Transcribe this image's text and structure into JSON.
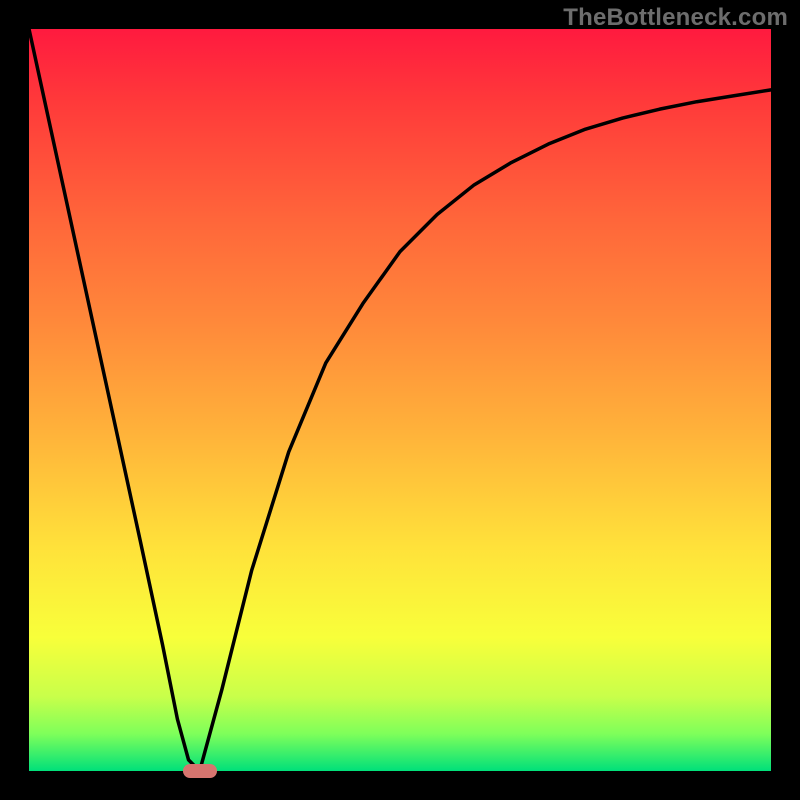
{
  "watermark": "TheBottleneck.com",
  "chart_data": {
    "type": "line",
    "title": "",
    "xlabel": "",
    "ylabel": "",
    "xlim": [
      0,
      100
    ],
    "ylim": [
      0,
      100
    ],
    "series": [
      {
        "name": "bottleneck-curve",
        "x": [
          0,
          5,
          10,
          15,
          18,
          20,
          21.5,
          23,
          26,
          30,
          35,
          40,
          45,
          50,
          55,
          60,
          65,
          70,
          75,
          80,
          85,
          90,
          95,
          100
        ],
        "values": [
          100,
          77,
          54,
          31,
          17,
          7,
          1.5,
          0,
          11,
          27,
          43,
          55,
          63,
          70,
          75,
          79,
          82,
          84.5,
          86.5,
          88,
          89.2,
          90.2,
          91,
          91.8
        ]
      }
    ],
    "marker": {
      "x": 23,
      "y": 0
    },
    "gradient_stops": [
      {
        "pos": 0,
        "color": "#ff1a3f"
      },
      {
        "pos": 25,
        "color": "#ff643a"
      },
      {
        "pos": 55,
        "color": "#ffb43a"
      },
      {
        "pos": 82,
        "color": "#f8ff3a"
      },
      {
        "pos": 100,
        "color": "#00e07a"
      }
    ]
  }
}
